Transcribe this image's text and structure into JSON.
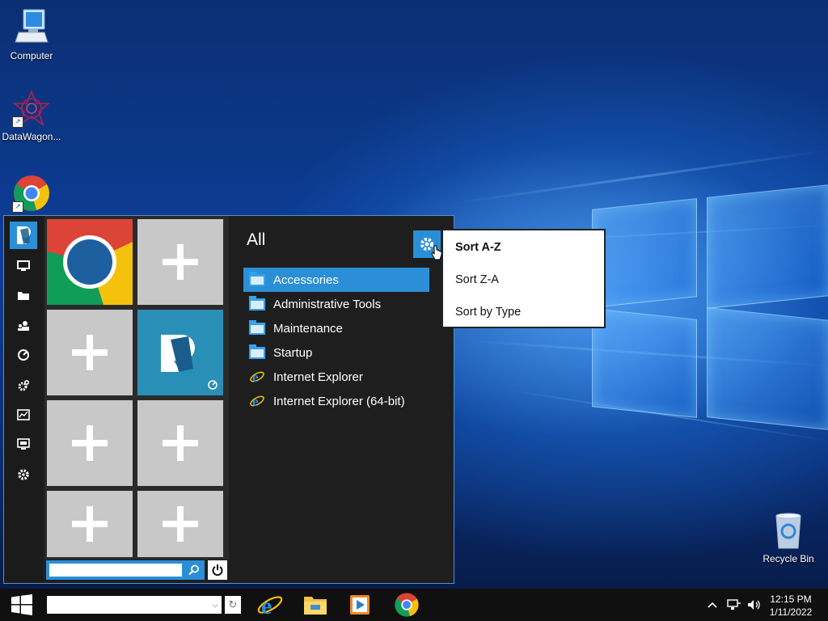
{
  "desktop": {
    "icons": [
      {
        "label": "Computer",
        "icon": "computer-icon"
      },
      {
        "label": "DataWagon...",
        "icon": "datawagon-icon"
      },
      {
        "label": "",
        "icon": "chrome-icon"
      },
      {
        "label": "Recycle Bin",
        "icon": "recycle-bin-icon"
      }
    ]
  },
  "start_menu": {
    "rail_icons": [
      "app-logo-icon",
      "computer-icon",
      "folder-icon",
      "users-icon",
      "network-icon",
      "settings-gear-icon",
      "performance-icon",
      "display-icon",
      "gear-icon"
    ],
    "tiles": [
      {
        "kind": "chrome"
      },
      {
        "kind": "add"
      },
      {
        "kind": "add"
      },
      {
        "kind": "app"
      },
      {
        "kind": "add"
      },
      {
        "kind": "add"
      },
      {
        "kind": "add"
      },
      {
        "kind": "add"
      }
    ],
    "search_placeholder": "",
    "section_title": "All",
    "programs": [
      {
        "label": "Accessories",
        "icon": "folder-icon",
        "selected": true
      },
      {
        "label": "Administrative Tools",
        "icon": "folder-icon",
        "selected": false
      },
      {
        "label": "Maintenance",
        "icon": "folder-icon",
        "selected": false
      },
      {
        "label": "Startup",
        "icon": "folder-icon",
        "selected": false
      },
      {
        "label": "Internet Explorer",
        "icon": "internet-explorer-icon",
        "selected": false
      },
      {
        "label": "Internet Explorer (64-bit)",
        "icon": "internet-explorer-icon",
        "selected": false
      }
    ]
  },
  "sort_menu": {
    "items": [
      "Sort A-Z",
      "Sort Z-A",
      "Sort by Type"
    ],
    "active": "Sort A-Z"
  },
  "taskbar": {
    "search_value": "",
    "pinned": [
      "internet-explorer-icon",
      "file-explorer-icon",
      "media-player-icon",
      "chrome-icon"
    ],
    "time": "12:15 PM",
    "date": "1/11/2022"
  },
  "colors": {
    "accent": "#2b8fd8",
    "menu_bg": "#1e1e1e",
    "tile_gray": "#c8c8c8"
  }
}
